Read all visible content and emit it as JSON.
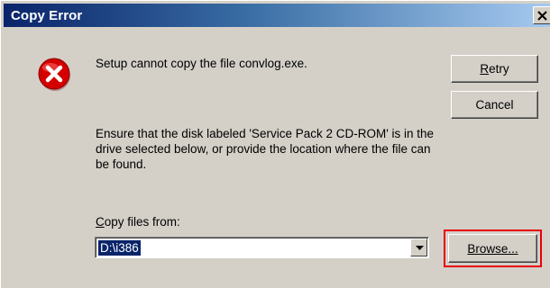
{
  "window": {
    "title": "Copy Error"
  },
  "icons": {
    "error": "error-icon",
    "close": "close-icon",
    "dropdown": "chevron-down-icon"
  },
  "message": {
    "primary": "Setup cannot copy the file convlog.exe.",
    "secondary": "Ensure that the disk labeled 'Service Pack 2 CD-ROM' is in the drive selected below, or provide the location where the file can be found."
  },
  "copy_from": {
    "label_accel": "C",
    "label_rest": "opy files from:",
    "value": "D:\\i386"
  },
  "buttons": {
    "retry_accel": "R",
    "retry_rest": "etry",
    "cancel": "Cancel",
    "browse": "Browse..."
  },
  "colors": {
    "titlebar_start": "#0a246a",
    "titlebar_end": "#a6caf0",
    "dialog_face": "#d4d0c8",
    "highlight_border": "#e8000d",
    "error_red": "#d40000"
  }
}
